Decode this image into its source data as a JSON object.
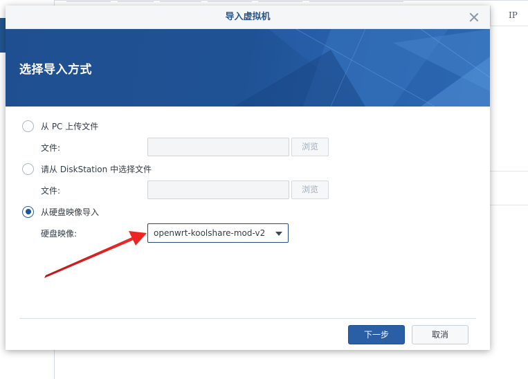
{
  "background": {
    "column_header_ip": "IP"
  },
  "dialog": {
    "title": "导入虚拟机",
    "heading": "选择导入方式",
    "options": [
      {
        "label": "从 PC 上传文件",
        "selected": false,
        "field_label": "文件:",
        "field_value": "",
        "browse_label": "浏览"
      },
      {
        "label": "请从 DiskStation 中选择文件",
        "selected": false,
        "field_label": "文件:",
        "field_value": "",
        "browse_label": "浏览"
      },
      {
        "label": "从硬盘映像导入",
        "selected": true,
        "field_label": "硬盘映像:",
        "select_value": "openwrt-koolshare-mod-v2"
      }
    ],
    "buttons": {
      "next": "下一步",
      "cancel": "取消"
    }
  },
  "colors": {
    "banner": "#1f4f90",
    "primary_button": "#2a5ea5",
    "title_text": "#2b5486",
    "annotation_arrow": "#e02020"
  },
  "icons": {
    "close": "close-icon",
    "dropdown": "chevron-down-icon",
    "annotation": "red-arrow-icon"
  }
}
